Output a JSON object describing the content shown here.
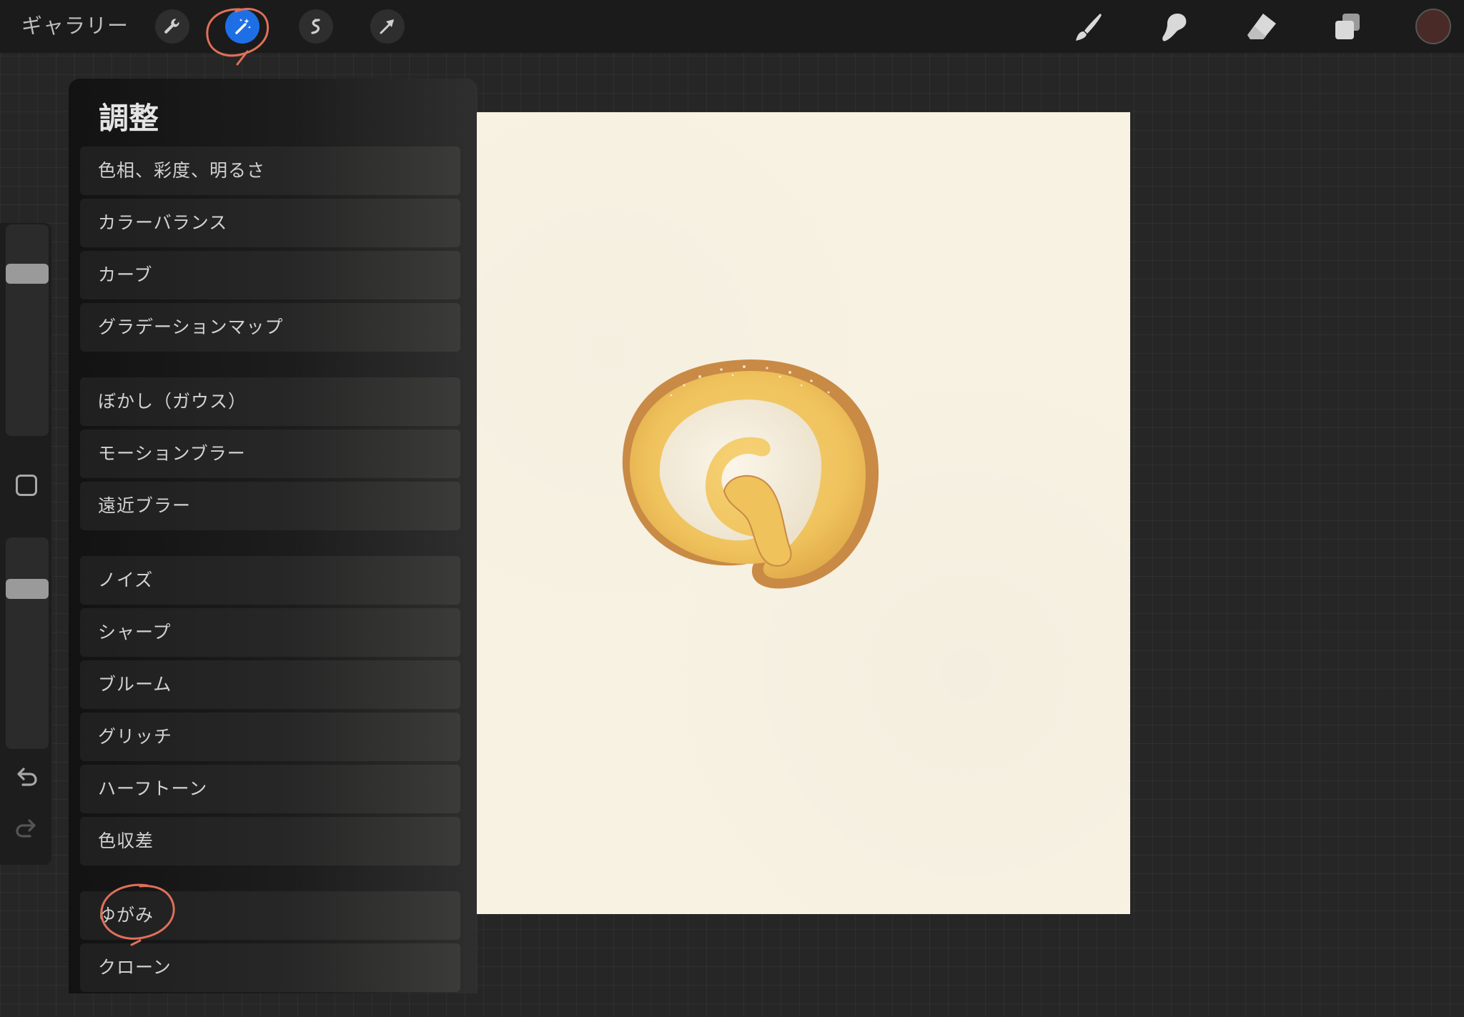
{
  "topbar": {
    "gallery_label": "ギャラリー",
    "tools_left": [
      {
        "name": "wrench-icon",
        "label": "Actions"
      },
      {
        "name": "magic-wand-icon",
        "label": "Adjustments",
        "active": true
      },
      {
        "name": "selection-icon",
        "label": "Selection"
      },
      {
        "name": "transform-arrow-icon",
        "label": "Transform"
      }
    ],
    "tools_right": [
      {
        "name": "brush-icon",
        "label": "Paint"
      },
      {
        "name": "smudge-icon",
        "label": "Smudge"
      },
      {
        "name": "eraser-icon",
        "label": "Erase"
      },
      {
        "name": "layers-icon",
        "label": "Layers"
      }
    ],
    "current_color": "#4a2a26",
    "accent_color": "#1e6fe6",
    "annotation_color": "#e0705a"
  },
  "sidebar": {
    "brush_size_level": 0.2,
    "opacity_level": 0.25
  },
  "panel": {
    "title": "調整",
    "groups": [
      {
        "items": [
          "色相、彩度、明るさ",
          "カラーバランス",
          "カーブ",
          "グラデーションマップ"
        ]
      },
      {
        "items": [
          "ぼかし（ガウス）",
          "モーションブラー",
          "遠近ブラー"
        ]
      },
      {
        "items": [
          "ノイズ",
          "シャープ",
          "ブルーム",
          "グリッチ",
          "ハーフトーン",
          "色収差"
        ]
      },
      {
        "items": [
          "ゆがみ",
          "クローン"
        ]
      }
    ],
    "highlighted_item": "ゆがみ"
  },
  "canvas": {
    "paper_color": "#f8f2e3",
    "artwork": "swiss-roll-cake-watercolor"
  }
}
